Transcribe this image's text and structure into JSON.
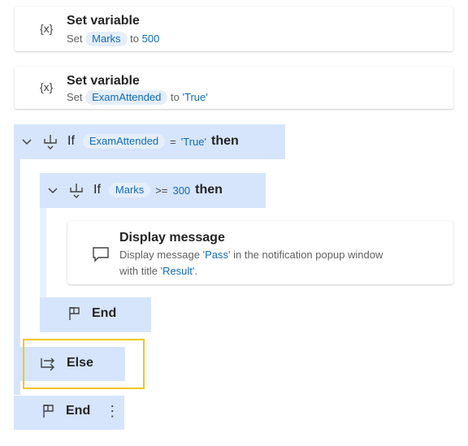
{
  "steps": {
    "set1": {
      "title": "Set variable",
      "set_word": "Set",
      "var": "Marks",
      "to_word": "to",
      "value": "500"
    },
    "set2": {
      "title": "Set variable",
      "set_word": "Set",
      "var": "ExamAttended",
      "to_word": "to",
      "value": "'True'"
    },
    "if1": {
      "keyword": "If",
      "var": "ExamAttended",
      "op": "=",
      "value": "'True'",
      "then": "then"
    },
    "if2": {
      "keyword": "If",
      "var": "Marks",
      "op": ">=",
      "value": "300",
      "then": "then"
    },
    "display": {
      "title": "Display message",
      "line1_pre": "Display message ",
      "line1_val": "'Pass'",
      "line1_post": " in the notification popup window",
      "line2_pre": "with title ",
      "line2_val": "'Result'",
      "line2_post": "."
    },
    "end_inner": {
      "label": "End"
    },
    "else": {
      "label": "Else"
    },
    "end_outer": {
      "label": "End",
      "more": "⋮"
    }
  },
  "icons": {
    "variable": "{x}"
  },
  "colors": {
    "block_bg": "#d6e5fb",
    "highlight": "#f2c811",
    "chip_bg": "#e5eefa",
    "link": "#0f6cbd"
  }
}
